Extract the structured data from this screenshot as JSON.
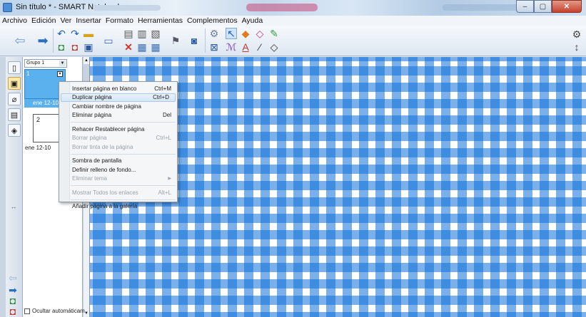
{
  "window": {
    "title": "Sin título * - SMART Notebook",
    "minimize": "–",
    "maximize": "▢",
    "close": "✕"
  },
  "menu": [
    "Archivo",
    "Edición",
    "Ver",
    "Insertar",
    "Formato",
    "Herramientas",
    "Complementos",
    "Ayuda"
  ],
  "toolbar": {
    "icons": [
      "back-arrow-icon",
      "forward-arrow-icon",
      "undo-icon",
      "redo-icon",
      "open-folder-icon",
      "add-page-icon",
      "delete-page-icon",
      "save-icon",
      "screen-shade-icon",
      "delete-icon",
      "table-icon",
      "screen-capture-icon",
      "dual-page-icon",
      "document-camera-icon",
      "properties-icon",
      "select-icon",
      "shape-fill-icon",
      "eraser-icon",
      "magic-pen-icon",
      "pens-icon",
      "text-icon",
      "line-icon",
      "shapes-icon",
      "settings-icon",
      "move-toolbar-icon"
    ]
  },
  "side_tabs": [
    "page-sorter-tab",
    "gallery-tab",
    "attachments-tab",
    "properties-tab",
    "addons-tab"
  ],
  "sorter": {
    "group": "Grupo 1",
    "pages": [
      {
        "number": "1",
        "label": "ene 12-10"
      },
      {
        "number": "2",
        "label": "ene 12-10"
      }
    ],
    "autohide_label": "Ocultar automáticam"
  },
  "context_menu": {
    "items": [
      {
        "label": "Insertar página en blanco",
        "shortcut": "Ctrl+M",
        "enabled": true
      },
      {
        "label": "Duplicar página",
        "shortcut": "Ctrl+D",
        "enabled": true,
        "highlighted": true
      },
      {
        "label": "Cambiar nombre de página",
        "shortcut": "",
        "enabled": true
      },
      {
        "label": "Eliminar página",
        "shortcut": "Del",
        "enabled": true
      },
      {
        "label": "Rehacer Restablecer página",
        "shortcut": "",
        "enabled": true
      },
      {
        "label": "Borrar página",
        "shortcut": "Ctrl+L",
        "enabled": false
      },
      {
        "label": "Borrar tinta de la página",
        "shortcut": "",
        "enabled": false
      },
      {
        "label": "Sombra de pantalla",
        "shortcut": "",
        "enabled": true
      },
      {
        "label": "Definir relleno de fondo...",
        "shortcut": "",
        "enabled": true
      },
      {
        "label": "Eliminar tema",
        "shortcut": "",
        "enabled": false
      },
      {
        "label": "Mostrar Todos los enlaces",
        "shortcut": "Alt+L",
        "enabled": false
      },
      {
        "label": "Añadir página a la galería",
        "shortcut": "",
        "enabled": true
      }
    ]
  },
  "colors": {
    "canvas_check": "#0e70d8",
    "thumb_selected": "#5ab1ee"
  }
}
